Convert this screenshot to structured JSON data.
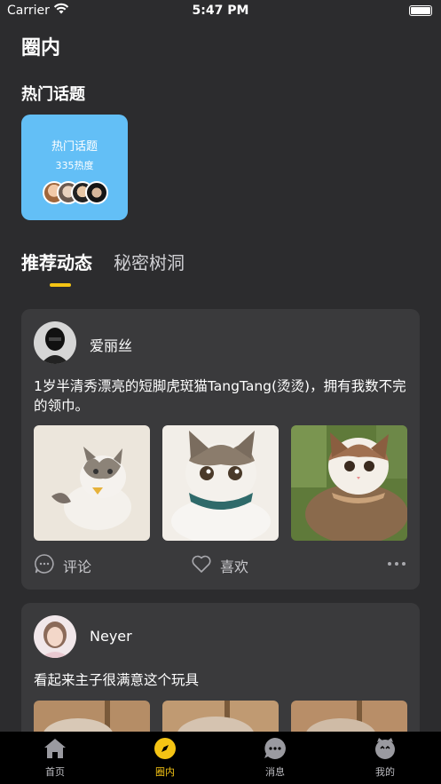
{
  "status_bar": {
    "carrier": "Carrier",
    "time": "5:47 PM"
  },
  "page": {
    "title": "圈内"
  },
  "hot_topics": {
    "section_title": "热门话题",
    "card": {
      "title": "热门话题",
      "heat": "335热度",
      "bg_color": "#63bff6"
    }
  },
  "feed_tabs": [
    {
      "label": "推荐动态",
      "active": true
    },
    {
      "label": "秘密树洞",
      "active": false
    }
  ],
  "accent_color": "#f5c414",
  "posts": [
    {
      "username": "爱丽丝",
      "content": "1岁半清秀漂亮的短脚虎斑猫TangTang(烫烫)，拥有我数不完的领巾。",
      "actions": {
        "comment": "评论",
        "like": "喜欢"
      }
    },
    {
      "username": "Neyer",
      "content": "看起来主子很满意这个玩具"
    }
  ],
  "tab_bar": [
    {
      "label": "首页",
      "icon": "home-icon",
      "active": false
    },
    {
      "label": "圈内",
      "icon": "compass-icon",
      "active": true
    },
    {
      "label": "消息",
      "icon": "message-icon",
      "active": false
    },
    {
      "label": "我的",
      "icon": "profile-icon",
      "active": false
    }
  ]
}
